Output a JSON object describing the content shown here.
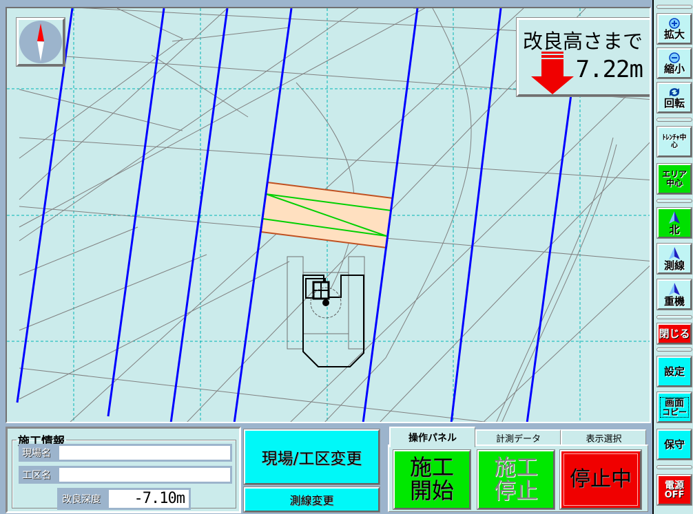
{
  "map": {
    "background": "#cbebeb",
    "grid_color": "#00b4b4",
    "survey_line_color": "#0000ff",
    "area_fill": "#ffe0c0",
    "area_border": "#c05020",
    "trench_line_color": "#00d000",
    "compass_icon": "north-arrow-icon"
  },
  "target": {
    "title": "改良高さまで",
    "value": "7.22m",
    "direction": "down",
    "arrow_color": "#f00000"
  },
  "toolbar": {
    "zoom_in": "拡大",
    "zoom_out": "縮小",
    "rotate": "回転",
    "trencher_center": "ﾄﾚﾝﾁｬ中心",
    "area_center": "エリア中心",
    "north": "北",
    "survey_line": "測線",
    "machine": "重機",
    "close": "閉じる",
    "settings": "設定",
    "screen_copy_1": "画面",
    "screen_copy_2": "コピー",
    "maintenance": "保守",
    "power_1": "電源",
    "power_2": "OFF"
  },
  "info": {
    "legend": "施工情報",
    "site_label": "現場名",
    "site_value": "",
    "section_label": "工区名",
    "section_value": "",
    "depth_label": "改良深度",
    "depth_value": "-7.10m"
  },
  "mid": {
    "change_site": "現場/工区変更",
    "change_line": "測線変更"
  },
  "tabs": {
    "items": [
      "操作パネル",
      "計測データ",
      "表示選択"
    ],
    "active": 0
  },
  "ops": {
    "start_1": "施工",
    "start_2": "開始",
    "stop_1": "施工",
    "stop_2": "停止",
    "status": "停止中"
  }
}
